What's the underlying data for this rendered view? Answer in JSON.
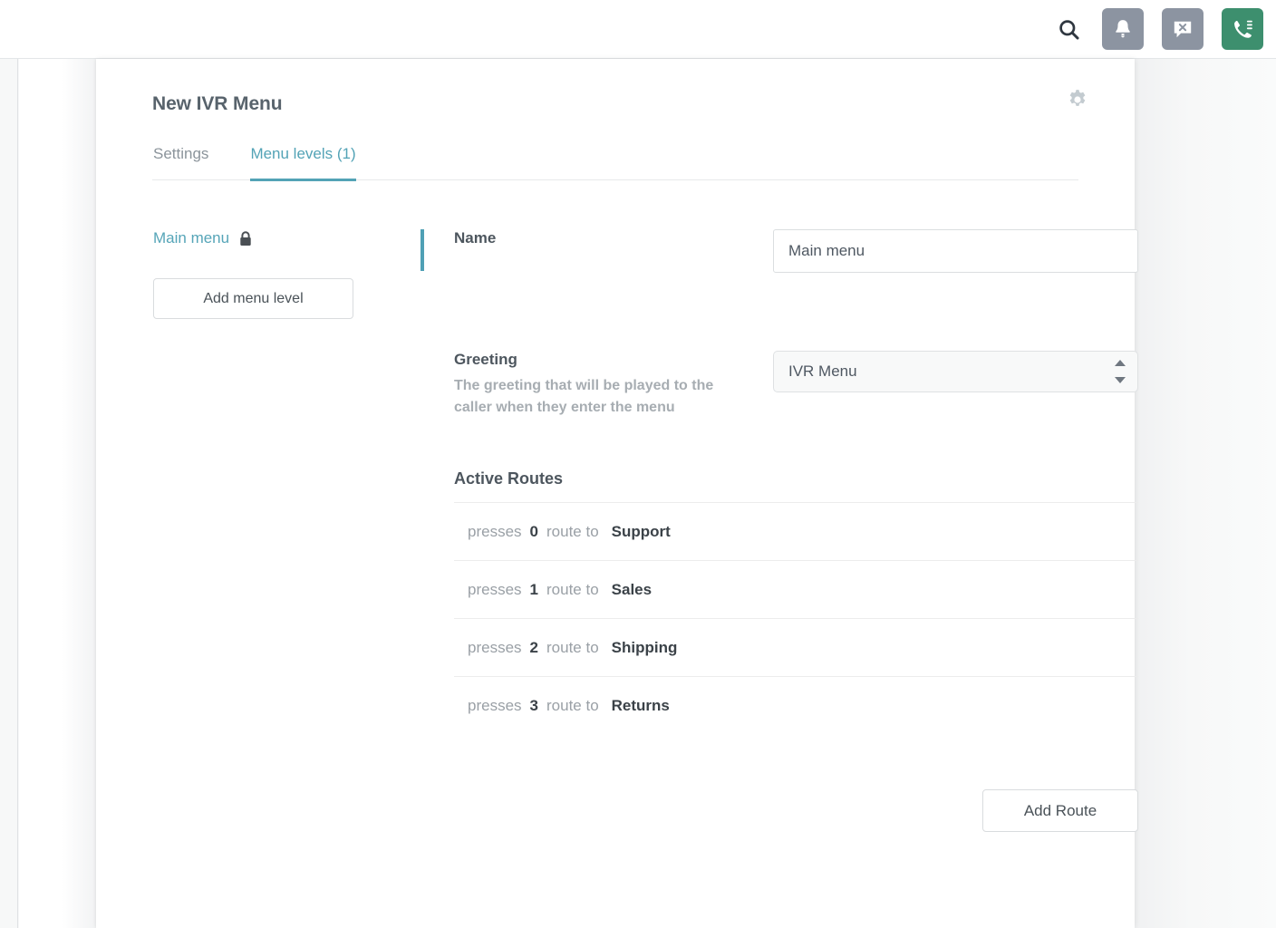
{
  "topbar": {
    "icons": [
      {
        "name": "search-icon",
        "label": "Search"
      },
      {
        "name": "bell-icon",
        "label": "Notifications"
      },
      {
        "name": "chat-dismiss-icon",
        "label": "Messages"
      },
      {
        "name": "phone-menu-icon",
        "label": "Call menu"
      }
    ],
    "colors": {
      "gray_button": "#8c94a1",
      "green_button": "#3d8f6e",
      "search_glyph": "#2f3740"
    }
  },
  "header": {
    "title": "New IVR Menu",
    "settings_icon": "gear-icon"
  },
  "tabs": [
    {
      "label": "Settings",
      "active": false
    },
    {
      "label": "Menu levels (1)",
      "active": true
    }
  ],
  "sidebar": {
    "menu_level_label": "Main menu",
    "menu_level_locked": true,
    "lock_icon": "lock-icon",
    "add_level_label": "Add menu level"
  },
  "form": {
    "name": {
      "label": "Name",
      "value": "Main menu",
      "placeholder": "Main menu"
    },
    "greeting": {
      "label": "Greeting",
      "help": "The greeting that will be played to the caller when they enter the menu",
      "selected": "IVR Menu"
    }
  },
  "routes": {
    "title": "Active Routes",
    "prefix": "presses",
    "middle": "route to",
    "items": [
      {
        "key": "0",
        "destination": "Support"
      },
      {
        "key": "1",
        "destination": "Sales"
      },
      {
        "key": "2",
        "destination": "Shipping"
      },
      {
        "key": "3",
        "destination": "Returns"
      }
    ],
    "add_route_label": "Add Route"
  },
  "theme": {
    "accent_teal": "#53a3b6",
    "text_dark": "#3b4248",
    "text_muted": "#9aa0a6"
  }
}
